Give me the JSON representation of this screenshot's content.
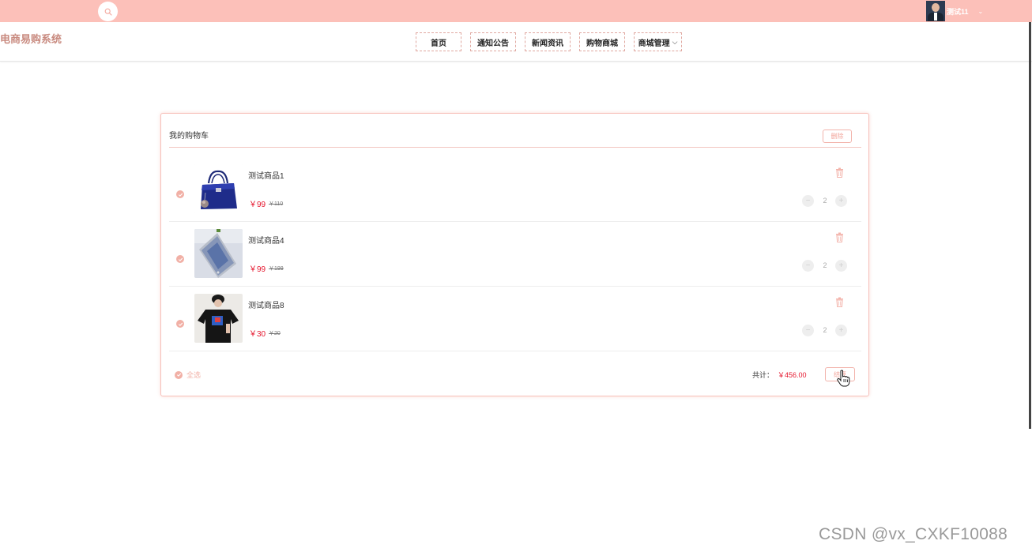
{
  "app": {
    "logo": "电商易购系统",
    "user_name": "测试11",
    "user_caret": "⌄"
  },
  "nav": {
    "items": [
      {
        "label": "首页"
      },
      {
        "label": "通知公告"
      },
      {
        "label": "新闻资讯"
      },
      {
        "label": "购物商城"
      },
      {
        "label": "商城管理",
        "chevron": "⌵"
      }
    ]
  },
  "cart": {
    "title": "我的购物车",
    "delete_all_label": "删除",
    "items": [
      {
        "name": "测试商品1",
        "price": "￥99",
        "old_price": "￥110",
        "quantity": "2",
        "minus": "−",
        "plus": "+",
        "image": "handbag"
      },
      {
        "name": "测试商品4",
        "price": "￥99",
        "old_price": "￥199",
        "quantity": "2",
        "minus": "−",
        "plus": "+",
        "image": "phone"
      },
      {
        "name": "测试商品8",
        "price": "￥30",
        "old_price": "￥20",
        "quantity": "2",
        "minus": "−",
        "plus": "+",
        "image": "t-shirt"
      }
    ],
    "select_all_label": "全选",
    "total_label": "共计：",
    "total_value": "￥456.00",
    "checkout_label": "结算"
  },
  "watermark": "CSDN @vx_CXKF10088",
  "colors": {
    "topbar": "#fcc0b9",
    "accent": "#f1b0a6",
    "price": "#e5162d",
    "logo": "#c98b80"
  },
  "icons": {
    "search": "magnifier",
    "trash": "trash-can",
    "check": "check-circle",
    "cursor": "hand-pointer"
  }
}
